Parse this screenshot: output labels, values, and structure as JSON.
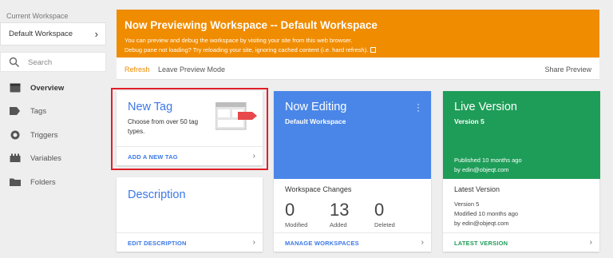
{
  "sidebar": {
    "workspace_label": "Current Workspace",
    "workspace_name": "Default Workspace",
    "search_placeholder": "Search",
    "items": [
      {
        "label": "Overview",
        "icon": "overview-icon"
      },
      {
        "label": "Tags",
        "icon": "tag-icon"
      },
      {
        "label": "Triggers",
        "icon": "trigger-icon"
      },
      {
        "label": "Variables",
        "icon": "variables-icon"
      },
      {
        "label": "Folders",
        "icon": "folder-icon"
      }
    ]
  },
  "banner": {
    "title": "Now Previewing Workspace -- Default Workspace",
    "line1": "You can preview and debug the workspace by visiting your site from this web browser.",
    "line2": "Debug pane not loading? Try reloading your site, ignoring cached content (i.e. hard refresh).",
    "refresh": "Refresh",
    "leave": "Leave Preview Mode",
    "share": "Share Preview",
    "color": "#f08c00"
  },
  "new_tag": {
    "title": "New Tag",
    "description": "Choose from over 50 tag types.",
    "link": "ADD A NEW TAG"
  },
  "description_card": {
    "title": "Description",
    "link": "EDIT DESCRIPTION"
  },
  "now_editing": {
    "title": "Now Editing",
    "subtitle": "Default Workspace",
    "changes_label": "Workspace Changes",
    "stats": [
      {
        "value": "0",
        "label": "Modified"
      },
      {
        "value": "13",
        "label": "Added"
      },
      {
        "value": "0",
        "label": "Deleted"
      }
    ],
    "link": "MANAGE WORKSPACES",
    "color": "#4a86e8"
  },
  "live_version": {
    "title": "Live Version",
    "subtitle": "Version 5",
    "published": "Published 10 months ago",
    "by": "by edin@objeqt.com",
    "body_title": "Latest Version",
    "body_lines": [
      "Version 5",
      "Modified 10 months ago",
      "by edin@objeqt.com"
    ],
    "link": "LATEST VERSION",
    "color": "#1e9d58"
  }
}
